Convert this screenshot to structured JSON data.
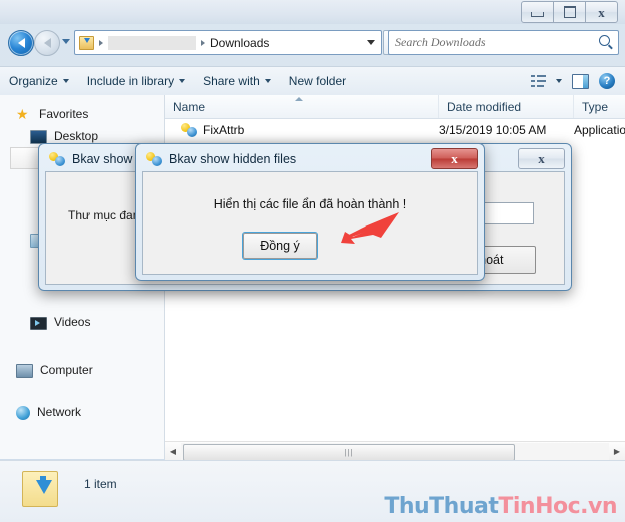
{
  "window": {
    "controls": {
      "minimize": "Minimize",
      "maximize": "Maximize",
      "close": "Close"
    }
  },
  "address_bar": {
    "back_tooltip": "Back",
    "forward_tooltip": "Forward",
    "history_tooltip": "Recent pages",
    "breadcrumb": [
      {
        "label": "",
        "redacted": true
      },
      {
        "label": "Downloads",
        "redacted": false
      }
    ],
    "refresh_label": "↻",
    "search": {
      "placeholder": "Search Downloads",
      "value": ""
    }
  },
  "command_bar": {
    "items": [
      {
        "label": "Organize",
        "has_caret": true
      },
      {
        "label": "Include in library",
        "has_caret": true
      },
      {
        "label": "Share with",
        "has_caret": true
      },
      {
        "label": "New folder",
        "has_caret": false
      }
    ],
    "view_button": "Change your view",
    "preview_pane_button": "Show the preview pane",
    "help_button": "?"
  },
  "nav_pane": {
    "items": [
      {
        "label": "Favorites",
        "icon": "star-icon",
        "level": 0
      },
      {
        "label": "Desktop",
        "icon": "desktop-icon",
        "level": 1
      },
      {
        "label": "Computer",
        "icon": "computer-icon",
        "level": 0
      },
      {
        "label": "Network",
        "icon": "network-icon",
        "level": 0
      }
    ],
    "partial_items": [
      {
        "label": "Videos",
        "icon": "video-icon"
      }
    ]
  },
  "file_list": {
    "columns": [
      "Name",
      "Date modified",
      "Type"
    ],
    "sort_column": "Name",
    "sort_direction": "ascending",
    "rows": [
      {
        "name": "FixAttrb",
        "date_modified": "3/15/2019 10:05 AM",
        "type": "Application",
        "icon": "bkav-icon"
      }
    ]
  },
  "scrollbar": {
    "left_arrow": "◀",
    "right_arrow": "▶",
    "grip": "|||"
  },
  "status_bar": {
    "item_count": "1 item",
    "folder_icon": "downloads-folder-icon"
  },
  "watermark": {
    "part1": "ThuThuat",
    "part2": "TinHoc.vn"
  },
  "dialog_back": {
    "title": "Bkav show hidden files",
    "icon": "bkav-icon",
    "close_label": "x",
    "label": "Thư mục đang h",
    "input_value": "",
    "exit_button": "Thoát"
  },
  "dialog_front": {
    "title": "Bkav show hidden files",
    "icon": "bkav-icon",
    "close_label": "x",
    "message": "Hiển thị các file ẩn đã hoàn thành !",
    "ok_button": "Đồng ý",
    "annotation": "red-arrow-pointing-to-ok-button"
  },
  "colors": {
    "close_red": "#bb3c36",
    "focus_blue": "#4aa3d8",
    "arrow_red": "#f0423c",
    "watermark_blue": "#6ea4cf",
    "watermark_pink": "#f3909c"
  }
}
